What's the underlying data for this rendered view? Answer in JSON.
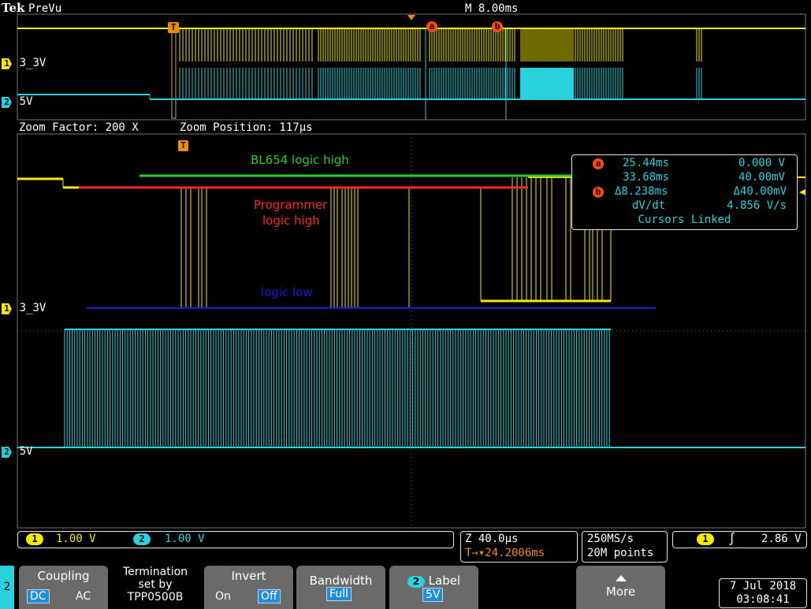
{
  "header": {
    "brand": "Tek",
    "mode": "PreVu",
    "timebase": "M 8.00ms"
  },
  "overview": {
    "ch1_label": "3_3V",
    "ch2_label": "5V",
    "cursor_a": "a",
    "cursor_b": "b",
    "trigger_marker": "T"
  },
  "zoom_info": {
    "factor": "Zoom Factor: 200 X",
    "position": "Zoom Position: 117µs"
  },
  "main": {
    "ch1_label": "3_3V",
    "ch2_label": "5V",
    "trigger_marker": "T",
    "annotations": {
      "bl654": "BL654 logic high",
      "programmer_line1": "Programmer",
      "programmer_line2": "logic high",
      "logic_low": "logic low"
    },
    "colors": {
      "ch1": "#f4e900",
      "ch2": "#27d2dc",
      "bl654": "#22d022",
      "programmer": "#ff2a1a",
      "logic_low": "#1a1ad8",
      "cursor_badge": "#ff4a10"
    }
  },
  "cursor_readout": {
    "a_badge": "a",
    "b_badge": "b",
    "a_time": "25.44ms",
    "a_volt": "0.000 V",
    "b_time": "33.68ms",
    "b_volt": "40.00mV",
    "delta_time": "Δ8.238ms",
    "delta_volt": "Δ40.00mV",
    "dvdt_label": "dV/dt",
    "dvdt_value": "4.856 V/s",
    "linked": "Cursors Linked"
  },
  "status_bar": {
    "ch1_num": "1",
    "ch1_scale": "1.00 V",
    "ch2_num": "2",
    "ch2_scale": "1.00 V",
    "zoom_scale": "Z 40.0µs",
    "trigger_pos": "T→▾24.2006ms",
    "sample_rate": "250MS/s",
    "record_length": "20M points",
    "trig_ch": "1",
    "trig_slope": "∫",
    "trig_level": "2.86 V"
  },
  "menu": {
    "channel": "2",
    "coupling": {
      "label": "Coupling",
      "opt1": "DC",
      "opt2": "AC"
    },
    "termination": {
      "line1": "Termination",
      "line2": "set by",
      "line3": "TPP0500B"
    },
    "invert": {
      "label": "Invert",
      "opt1": "On",
      "opt2": "Off"
    },
    "bandwidth": {
      "label": "Bandwidth",
      "value": "Full"
    },
    "label_btn": {
      "num": "2",
      "label": "Label",
      "value": "5V"
    },
    "more": {
      "label": "More"
    }
  },
  "datetime": {
    "date": "7 Jul  2018",
    "time": "03:08:41"
  }
}
